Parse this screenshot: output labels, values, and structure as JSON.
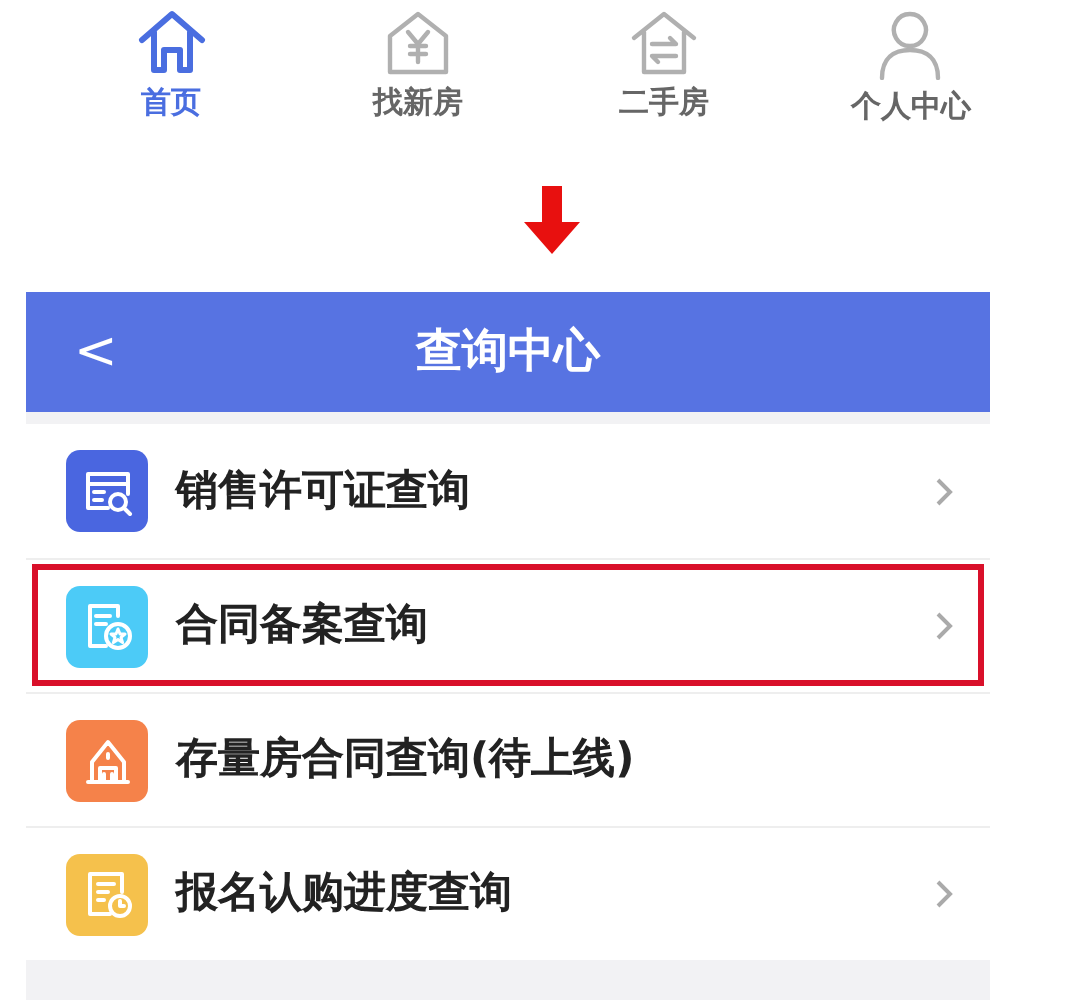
{
  "tab_bar": [
    {
      "kind": "home",
      "label": "首页",
      "selected": true
    },
    {
      "kind": "new-house",
      "label": "找新房",
      "selected": false
    },
    {
      "kind": "resale",
      "label": "二手房",
      "selected": false
    },
    {
      "kind": "profile",
      "label": "个人中心",
      "selected": false
    }
  ],
  "header": {
    "back": "<",
    "title": "查询中心"
  },
  "menu": [
    {
      "kind": "permit",
      "label": "销售许可证查询",
      "color": "#4a66e0",
      "chevron": true,
      "highlighted": false
    },
    {
      "kind": "contract",
      "label": "合同备案查询",
      "color": "#4ccbf7",
      "chevron": true,
      "highlighted": true
    },
    {
      "kind": "building",
      "label": "存量房合同查询(待上线)",
      "color": "#f5824a",
      "chevron": false,
      "highlighted": false
    },
    {
      "kind": "progress",
      "label": "报名认购进度查询",
      "color": "#f5c14c",
      "chevron": true,
      "highlighted": false
    }
  ]
}
